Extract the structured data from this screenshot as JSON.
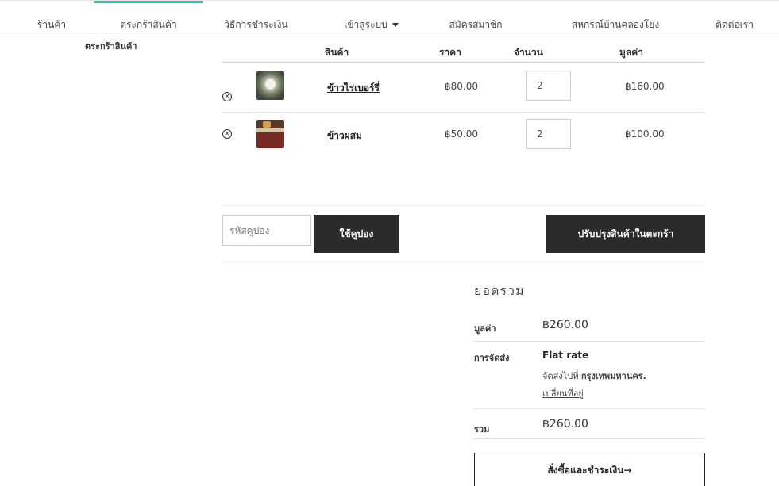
{
  "nav": {
    "shop": "ร้านค้า",
    "cart": "ตระกร้าสินค้า",
    "payment": "วิธีการชำระเงิน",
    "login": "เข้าสู่ระบบ",
    "register": "สมัครสมาชิก",
    "coop": "สหกรณ์บ้านคลองโยง",
    "contact": "ติดต่อเรา"
  },
  "breadcrumb": "ตระกร้าสินค้า",
  "table": {
    "headers": {
      "product": "สินค้า",
      "price": "ราคา",
      "quantity": "จำนวน",
      "subtotal": "มูลค่า"
    },
    "rows": [
      {
        "name": "ข้าวไร่เบอร์รี่",
        "price": "฿80.00",
        "qty": "2",
        "subtotal": "฿160.00",
        "remove_icon": "close-circle-icon"
      },
      {
        "name": "ข้าวผสม",
        "price": "฿50.00",
        "qty": "2",
        "subtotal": "฿100.00",
        "remove_icon": "close-circle-icon"
      }
    ]
  },
  "coupon": {
    "placeholder": "รหัสคูปอง",
    "apply_label": "ใช้คูปอง"
  },
  "update_cart_label": "ปรับปรุงสินค้าในตะกร้า",
  "totals": {
    "title": "ยอดรวม",
    "subtotal_label": "มูลค่า",
    "subtotal_value": "฿260.00",
    "shipping_label": "การจัดส่ง",
    "shipping_method": "Flat rate",
    "shipping_dest_prefix": "จัดส่งไปที่",
    "shipping_dest_city": "กรุงเทพมหานคร.",
    "change_address": "เปลี่ยนที่อยู่",
    "total_label": "รวม",
    "total_value": "฿260.00"
  },
  "checkout_label": "สั่งซื้อและชำระเงิน→",
  "colors": {
    "accent": "#25c4a6",
    "button_dark": "#2b2b2b"
  }
}
